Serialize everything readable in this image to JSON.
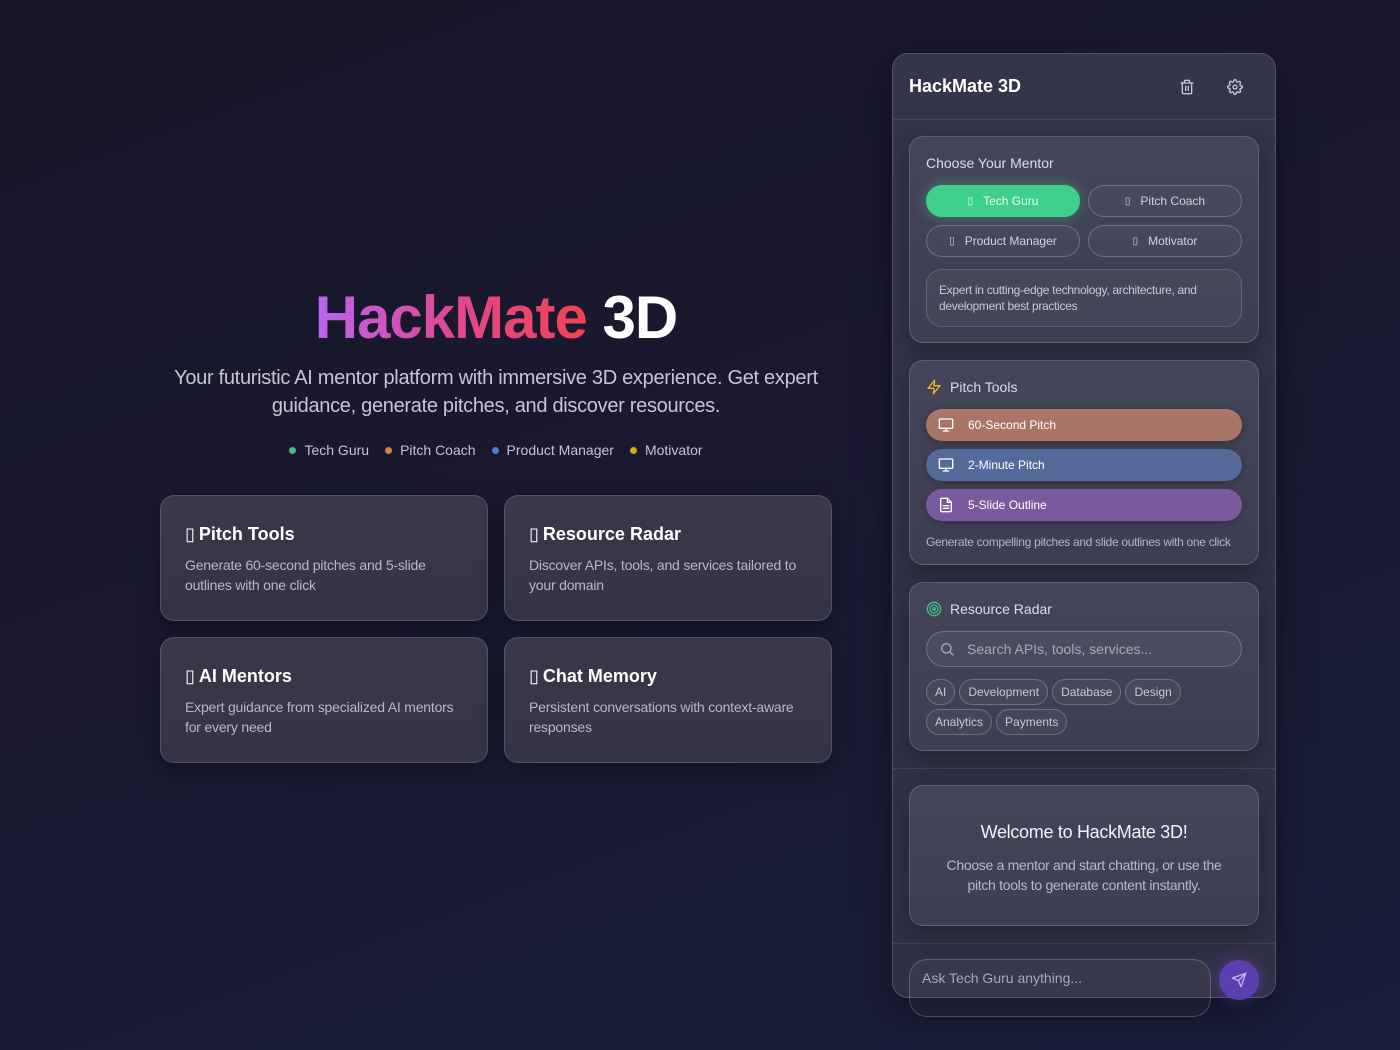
{
  "hero": {
    "title_gradient": "HackMate",
    "title_plain": "3D",
    "subtitle": "Your futuristic AI mentor platform with immersive 3D experience. Get expert guidance, generate pitches, and discover resources.",
    "legend": [
      {
        "label": "Tech Guru",
        "color": "#3ec27e"
      },
      {
        "label": "Pitch Coach",
        "color": "#d9814a"
      },
      {
        "label": "Product Manager",
        "color": "#4a7fd6"
      },
      {
        "label": "Motivator",
        "color": "#d4a526"
      }
    ]
  },
  "features": [
    {
      "glyph": "▯",
      "title": "Pitch Tools",
      "description": "Generate 60-second pitches and 5-slide outlines with one click"
    },
    {
      "glyph": "▯",
      "title": "Resource Radar",
      "description": "Discover APIs, tools, and services tailored to your domain"
    },
    {
      "glyph": "▯",
      "title": "AI Mentors",
      "description": "Expert guidance from specialized AI mentors for every need"
    },
    {
      "glyph": "▯",
      "title": "Chat Memory",
      "description": "Persistent conversations with context-aware responses"
    }
  ],
  "panel": {
    "title": "HackMate 3D",
    "mentor": {
      "heading": "Choose Your Mentor",
      "options": [
        {
          "label": "Tech Guru",
          "glyph": "▯",
          "active": true
        },
        {
          "label": "Pitch Coach",
          "glyph": "▯",
          "active": false
        },
        {
          "label": "Product Manager",
          "glyph": "▯",
          "active": false
        },
        {
          "label": "Motivator",
          "glyph": "▯",
          "active": false
        }
      ],
      "description": "Expert in cutting-edge technology, architecture, and development best practices"
    },
    "pitch": {
      "heading": "Pitch Tools",
      "buttons": [
        {
          "label": "60-Second Pitch",
          "color": "#a87566"
        },
        {
          "label": "2-Minute Pitch",
          "color": "#556a9a"
        },
        {
          "label": "5-Slide Outline",
          "color": "#7a5a9e"
        }
      ],
      "note": "Generate compelling pitches and slide outlines with one click"
    },
    "resource": {
      "heading": "Resource Radar",
      "search_placeholder": "Search APIs, tools, services...",
      "tags": [
        "AI",
        "Development",
        "Database",
        "Design",
        "Analytics",
        "Payments"
      ]
    },
    "welcome": {
      "title": "Welcome to HackMate 3D!",
      "text": "Choose a mentor and start chatting, or use the pitch tools to generate content instantly."
    },
    "chat": {
      "placeholder": "Ask Tech Guru anything..."
    }
  }
}
